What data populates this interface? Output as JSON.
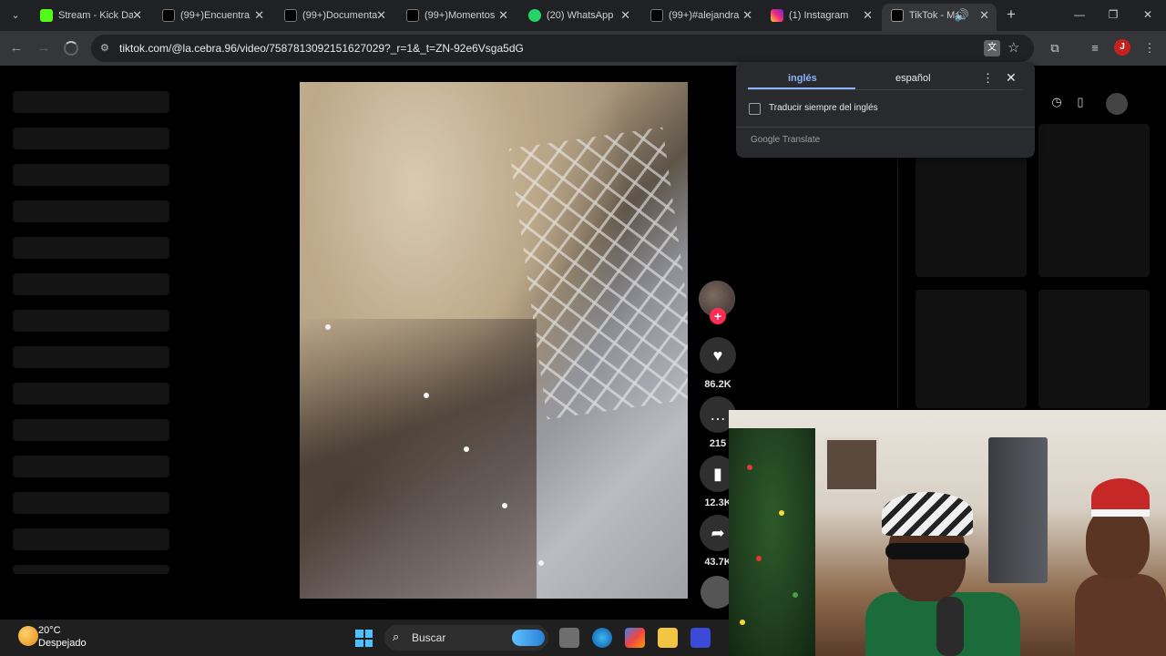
{
  "browser": {
    "tabs": [
      {
        "title": "Stream - Kick Da",
        "icon": "kick-icon",
        "color": "#53fc18"
      },
      {
        "title": "(99+)Encuentra",
        "icon": "tiktok-icon",
        "color": "#ffffff"
      },
      {
        "title": "(99+)Documenta",
        "icon": "tiktok-icon",
        "color": "#ffffff"
      },
      {
        "title": "(99+)Momentos",
        "icon": "tiktok-icon",
        "color": "#ffffff"
      },
      {
        "title": "(20) WhatsApp",
        "icon": "whatsapp-icon",
        "color": "#25d366"
      },
      {
        "title": "(99+)#alejandra",
        "icon": "tiktok-icon",
        "color": "#ffffff"
      },
      {
        "title": "(1) Instagram",
        "icon": "instagram-icon",
        "color": "#e1306c"
      },
      {
        "title": "TikTok - Ma",
        "icon": "tiktok-icon",
        "color": "#ffffff"
      }
    ],
    "url": "tiktok.com/@la.cebra.96/video/7587813092151627029?_r=1&_t=ZN-92e6Vsga5dG",
    "profile_initial": "J"
  },
  "translate_popup": {
    "tab_source": "inglés",
    "tab_target": "español",
    "always_translate_label": "Traducir siempre del inglés",
    "brand": "Google Translate"
  },
  "video_actions": {
    "likes": "86.2K",
    "comments": "215",
    "saves": "12.3K",
    "shares": "43.7K"
  },
  "taskbar": {
    "temperature": "20°C",
    "condition": "Despejado",
    "search_label": "Buscar"
  }
}
